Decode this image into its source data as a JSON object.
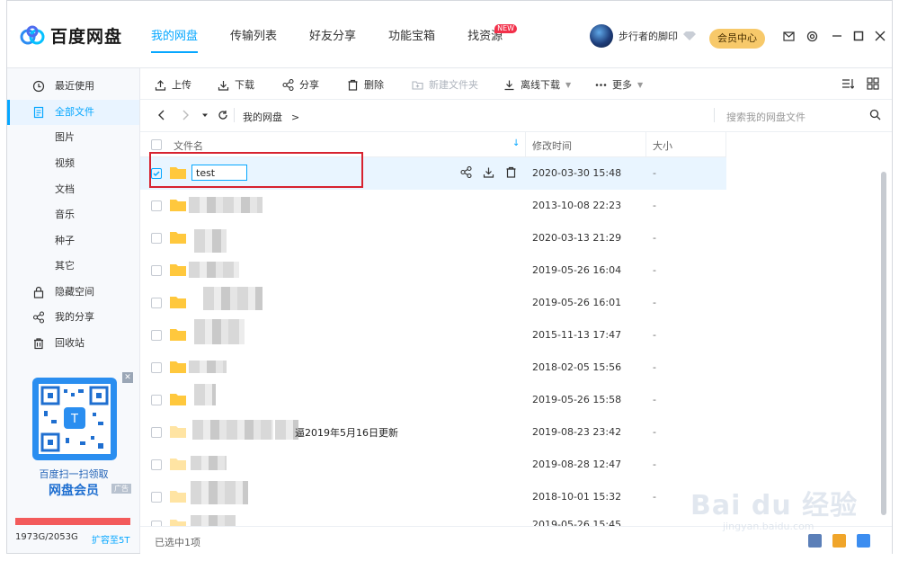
{
  "app": {
    "name": "百度网盘"
  },
  "nav": {
    "items": [
      {
        "label": "我的网盘",
        "active": true
      },
      {
        "label": "传输列表"
      },
      {
        "label": "好友分享"
      },
      {
        "label": "功能宝箱"
      },
      {
        "label": "找资源",
        "badge": "NEW"
      }
    ]
  },
  "user": {
    "name": "步行者的脚印",
    "vip_label": "会员中心"
  },
  "sidebar": {
    "items": [
      {
        "label": "最近使用",
        "icon": "clock-icon"
      },
      {
        "label": "全部文件",
        "icon": "file-icon",
        "active": true
      },
      {
        "label": "图片"
      },
      {
        "label": "视频"
      },
      {
        "label": "文档"
      },
      {
        "label": "音乐"
      },
      {
        "label": "种子"
      },
      {
        "label": "其它"
      },
      {
        "label": "隐藏空间",
        "icon": "lock-icon"
      },
      {
        "label": "我的分享",
        "icon": "share-icon"
      },
      {
        "label": "回收站",
        "icon": "trash-icon"
      }
    ],
    "ad": {
      "line1": "百度扫一扫领取",
      "line2": "网盘会员",
      "tag": "广告"
    },
    "storage": {
      "used_text": "1973G/2053G",
      "expand_label": "扩容至5T"
    }
  },
  "toolbar": {
    "upload": "上传",
    "download": "下载",
    "share": "分享",
    "delete": "删除",
    "new_folder": "新建文件夹",
    "offline_download": "离线下载",
    "more": "更多"
  },
  "pathbar": {
    "path": "我的网盘",
    "search_placeholder": "搜索我的网盘文件"
  },
  "table": {
    "col_name": "文件名",
    "col_time": "修改时间",
    "col_size": "大小",
    "rows": [
      {
        "name": "test",
        "time": "2020-03-30 15:48",
        "size": "-",
        "selected": true
      },
      {
        "name": "",
        "time": "2013-10-08 22:23",
        "size": "-"
      },
      {
        "name": "",
        "time": "2020-03-13 21:29",
        "size": "-"
      },
      {
        "name": "",
        "time": "2019-05-26 16:04",
        "size": "-"
      },
      {
        "name": "",
        "time": "2019-05-26 16:01",
        "size": "-"
      },
      {
        "name": "",
        "time": "2015-11-13 17:47",
        "size": "-"
      },
      {
        "name": "",
        "time": "2018-02-05 15:56",
        "size": "-"
      },
      {
        "name": "",
        "time": "2019-05-26 15:58",
        "size": "-"
      },
      {
        "name": "逼2019年5月16日更新",
        "time": "2019-08-23 23:42",
        "size": "-"
      },
      {
        "name": "",
        "time": "2019-08-28 12:47",
        "size": "-"
      },
      {
        "name": "",
        "time": "2018-10-01 15:32",
        "size": "-"
      },
      {
        "name": "",
        "time": "2019-05-26 15:45",
        "size": ""
      }
    ]
  },
  "status": {
    "text": "已选中1项"
  },
  "watermark": {
    "text": "Bai du 经验",
    "sub": "jingyan.baidu.com"
  },
  "colors": {
    "accent": "#06a7ff",
    "highlight": "#d7222f",
    "folder": "#ffc83d"
  }
}
